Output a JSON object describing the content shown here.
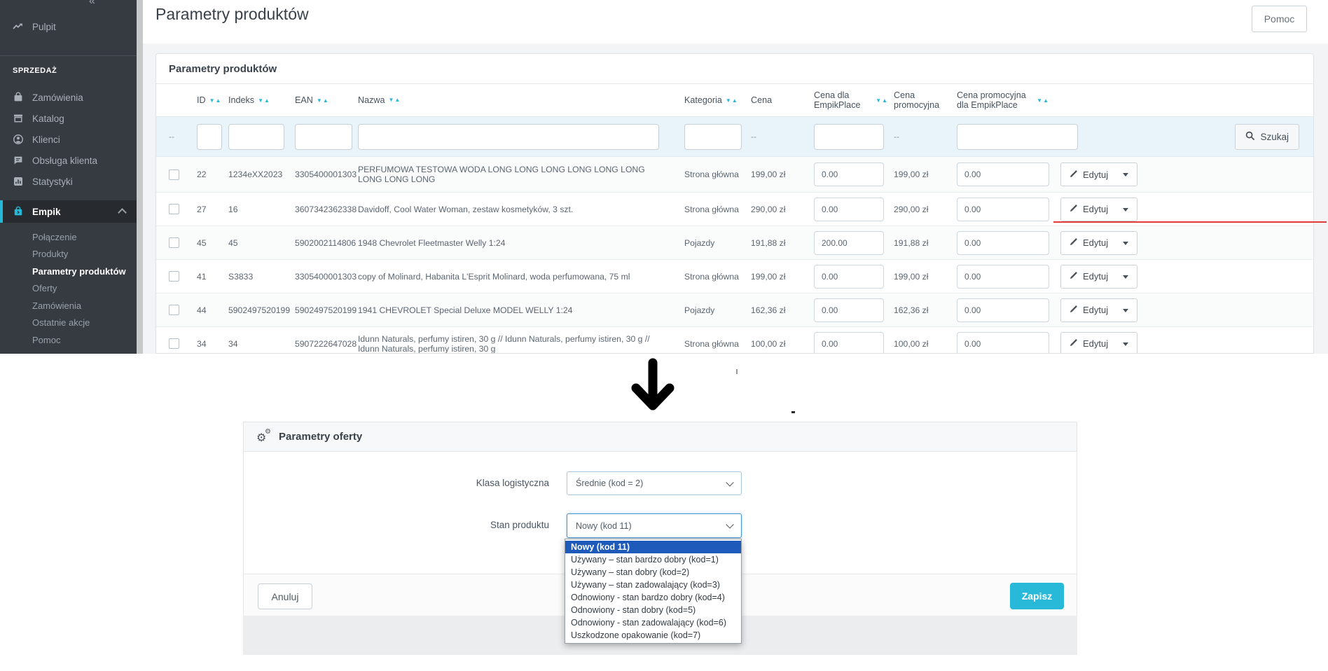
{
  "app": {
    "accent_color": "#25b9d7",
    "annotation_color": "#e23b3b",
    "dropdown_highlight_color": "#1d5ab9",
    "save_button_color": "#29b9d8"
  },
  "sidebar": {
    "collapse_icon": "«",
    "dashboard": {
      "label": "Pulpit",
      "icon": "trend"
    },
    "section": "SPRZEDAŻ",
    "items": [
      {
        "label": "Zamówienia",
        "icon": "cart"
      },
      {
        "label": "Katalog",
        "icon": "store"
      },
      {
        "label": "Klienci",
        "icon": "customers"
      },
      {
        "label": "Obsługa klienta",
        "icon": "chat"
      },
      {
        "label": "Statystyki",
        "icon": "stats"
      }
    ],
    "empik": {
      "label": "Empik",
      "icon": "bag",
      "chevron": "up"
    },
    "submenu": [
      {
        "label": "Połączenie",
        "active": false
      },
      {
        "label": "Produkty",
        "active": false
      },
      {
        "label": "Parametry produktów",
        "active": true
      },
      {
        "label": "Oferty",
        "active": false
      },
      {
        "label": "Zamówienia",
        "active": false
      },
      {
        "label": "Ostatnie akcje",
        "active": false
      },
      {
        "label": "Pomoc",
        "active": false
      }
    ]
  },
  "topbar": {
    "title": "Parametry produktów",
    "help_button": "Pomoc"
  },
  "panel": {
    "title": "Parametry produktów",
    "search_button": "Szukaj",
    "empty_filter": "--",
    "sort_icon_glyph": "▼▲",
    "edit_button": "Edytuj",
    "columns": [
      {
        "label": "ID",
        "sortable": true,
        "filter": "input"
      },
      {
        "label": "Indeks",
        "sortable": true,
        "filter": "input"
      },
      {
        "label": "EAN",
        "sortable": true,
        "filter": "input"
      },
      {
        "label": "Nazwa",
        "sortable": true,
        "filter": "input"
      },
      {
        "label": "Kategoria",
        "sortable": true,
        "filter": "input"
      },
      {
        "label": "Cena",
        "sortable": false,
        "filter": "dash"
      },
      {
        "label": "Cena dla EmpikPlace",
        "sortable": true,
        "filter": "input"
      },
      {
        "label": "Cena promocyjna",
        "sortable": false,
        "filter": "dash"
      },
      {
        "label": "Cena promocyjna dla EmpikPlace",
        "sortable": true,
        "filter": "input"
      }
    ],
    "rows": [
      {
        "id": "22",
        "indeks": "1234eXX2023",
        "ean": "3305400001303",
        "nazwa": "PERFUMOWA TESTOWA WODA LONG LONG LONG LONG LONG LONG LONG LONG LONG",
        "kategoria": "Strona główna",
        "cena": "199,00 zł",
        "cena_empikplace": "0.00",
        "cena_promocyjna": "199,00 zł",
        "cena_promocyjna_empikplace": "0.00",
        "annotated": false
      },
      {
        "id": "27",
        "indeks": "16",
        "ean": "3607342362338",
        "nazwa": "Davidoff, Cool Water Woman, zestaw kosmetyków, 3 szt.",
        "kategoria": "Strona główna",
        "cena": "290,00 zł",
        "cena_empikplace": "0.00",
        "cena_promocyjna": "290,00 zł",
        "cena_promocyjna_empikplace": "0.00",
        "annotated": true
      },
      {
        "id": "45",
        "indeks": "45",
        "ean": "5902002114806",
        "nazwa": "1948 Chevrolet Fleetmaster Welly 1:24",
        "kategoria": "Pojazdy",
        "cena": "191,88 zł",
        "cena_empikplace": "200.00",
        "cena_promocyjna": "191,88 zł",
        "cena_promocyjna_empikplace": "0.00",
        "annotated": false
      },
      {
        "id": "41",
        "indeks": "S3833",
        "ean": "3305400001303",
        "nazwa": "copy of Molinard, Habanita L'Esprit Molinard, woda perfumowana, 75 ml",
        "kategoria": "Strona główna",
        "cena": "199,00 zł",
        "cena_empikplace": "0.00",
        "cena_promocyjna": "199,00 zł",
        "cena_promocyjna_empikplace": "0.00",
        "annotated": false
      },
      {
        "id": "44",
        "indeks": "5902497520199",
        "ean": "5902497520199",
        "nazwa": "1941 CHEVROLET Special Deluxe MODEL WELLY 1:24",
        "kategoria": "Pojazdy",
        "cena": "162,36 zł",
        "cena_empikplace": "0.00",
        "cena_promocyjna": "162,36 zł",
        "cena_promocyjna_empikplace": "0.00",
        "annotated": false
      },
      {
        "id": "34",
        "indeks": "34",
        "ean": "5907222647028",
        "nazwa": "Idunn Naturals, perfumy istiren, 30 g // Idunn Naturals, perfumy istiren, 30 g // Idunn Naturals, perfumy istiren, 30 g",
        "kategoria": "Strona główna",
        "cena": "100,00 zł",
        "cena_empikplace": "0.00",
        "cena_promocyjna": "100,00 zł",
        "cena_promocyjna_empikplace": "0.00",
        "annotated": false
      }
    ]
  },
  "annotations": {
    "arrow": "down"
  },
  "modal": {
    "title": "Parametry oferty",
    "fields": [
      {
        "label": "Klasa logistyczna",
        "value": "Średnie (kod = 2)",
        "focused": false
      },
      {
        "label": "Stan produktu",
        "value": "Nowy (kod 11)",
        "focused": true
      }
    ],
    "dropdown": {
      "options": [
        {
          "label": "Nowy (kod 11)",
          "selected": true
        },
        {
          "label": "Używany – stan bardzo dobry (kod=1)",
          "selected": false
        },
        {
          "label": "Używany – stan dobry (kod=2)",
          "selected": false
        },
        {
          "label": "Używany – stan zadowalający (kod=3)",
          "selected": false
        },
        {
          "label": "Odnowiony - stan bardzo dobry (kod=4)",
          "selected": false
        },
        {
          "label": "Odnowiony - stan dobry (kod=5)",
          "selected": false
        },
        {
          "label": "Odnowiony - stan zadowalający (kod=6)",
          "selected": false
        },
        {
          "label": "Uszkodzone opakowanie (kod=7)",
          "selected": false
        }
      ]
    },
    "cancel_button": "Anuluj",
    "save_button": "Zapisz"
  }
}
